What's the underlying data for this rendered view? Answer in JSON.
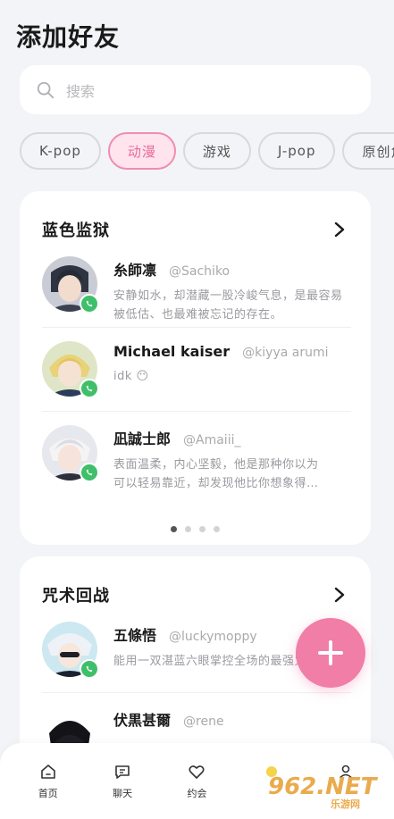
{
  "header": {
    "title": "添加好友"
  },
  "search": {
    "placeholder": "搜索"
  },
  "categories": [
    {
      "label": "K-pop",
      "active": false
    },
    {
      "label": "动漫",
      "active": true
    },
    {
      "label": "游戏",
      "active": false
    },
    {
      "label": "J-pop",
      "active": false
    },
    {
      "label": "原创角",
      "active": false
    }
  ],
  "sections": [
    {
      "title": "蓝色监狱",
      "people": [
        {
          "name": "糸師凛",
          "handle": "@Sachiko",
          "desc": "安静如水，却潜藏一股冷峻气息，是最容易被低估、也最难被忘记的存在。"
        },
        {
          "name": "Michael kaiser",
          "handle": "@kiyya arumi",
          "desc": "idk 😶"
        },
        {
          "name": "凪誠士郎",
          "handle": "@Amaiii_",
          "desc": "表面温柔，内心坚毅，他是那种你以为可以轻易靠近，却发现他比你想象得…"
        }
      ]
    },
    {
      "title": "咒术回战",
      "people": [
        {
          "name": "五條悟",
          "handle": "@luckymoppy",
          "desc": "能用一双湛蓝六眼掌控全场的最强咒术师。"
        },
        {
          "name": "伏黒甚爾",
          "handle": "@rene",
          "desc": ""
        }
      ]
    }
  ],
  "tabs": [
    {
      "label": "首页",
      "icon": "home-icon"
    },
    {
      "label": "聊天",
      "icon": "chat-icon"
    },
    {
      "label": "约会",
      "icon": "heart-icon"
    },
    {
      "label": "",
      "icon": "star-icon"
    },
    {
      "label": "",
      "icon": "profile-icon"
    }
  ],
  "watermark": {
    "text": "962.NET",
    "sub": "乐游网"
  },
  "colors": {
    "accent": "#f07ea6",
    "online": "#3fbf6a",
    "chip_active_bg": "#ffe4ee"
  }
}
